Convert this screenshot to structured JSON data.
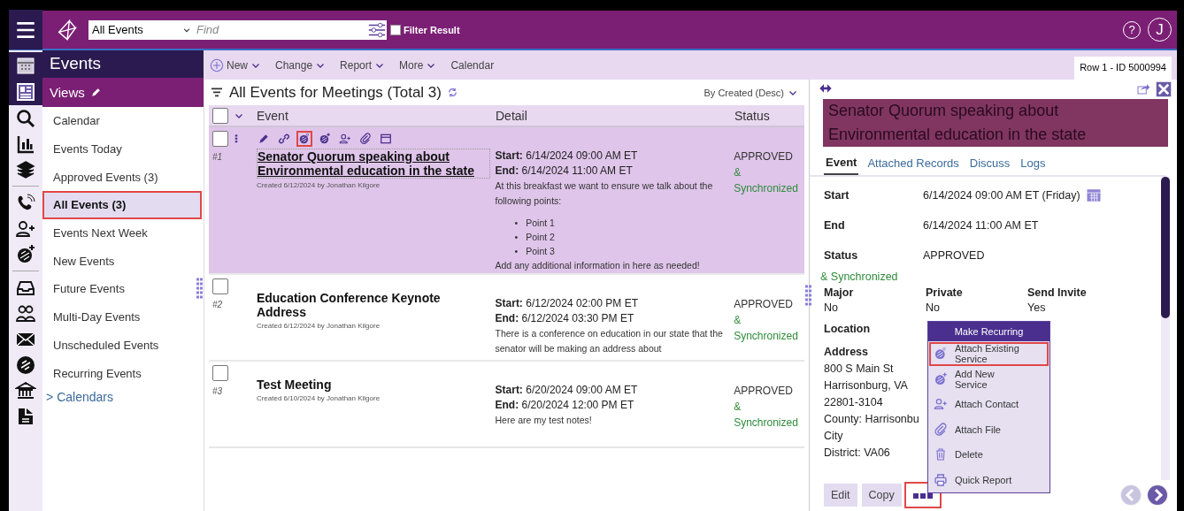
{
  "topbar": {
    "view_select": "All Events",
    "search": {
      "placeholder": "Find"
    },
    "filter_result": {
      "label": "Filter Result",
      "checked": false
    },
    "help": "?",
    "avatar": "J"
  },
  "module": {
    "title": "Events"
  },
  "views": {
    "title": "Views",
    "items": [
      {
        "label": "Calendar",
        "selected": false,
        "highlighted": false
      },
      {
        "label": "Events Today",
        "selected": false,
        "highlighted": false
      },
      {
        "label": "Approved Events (3)",
        "selected": false,
        "highlighted": false
      },
      {
        "label": "All Events (3)",
        "selected": true,
        "highlighted": true
      },
      {
        "label": "Events Next Week",
        "selected": false,
        "highlighted": false
      },
      {
        "label": "New Events",
        "selected": false,
        "highlighted": false
      },
      {
        "label": "Future Events",
        "selected": false,
        "highlighted": false
      },
      {
        "label": "Multi-Day Events",
        "selected": false,
        "highlighted": false
      },
      {
        "label": "Unscheduled Events",
        "selected": false,
        "highlighted": false
      },
      {
        "label": "Recurring Events",
        "selected": false,
        "highlighted": false
      }
    ],
    "calendars": {
      "marker": ">",
      "label": "Calendars",
      "expanded": false
    }
  },
  "toolbar": {
    "buttons": [
      {
        "label": "New",
        "kind": "add"
      },
      {
        "label": "Change",
        "kind": "menu"
      },
      {
        "label": "Report",
        "kind": "menu"
      },
      {
        "label": "More",
        "kind": "menu"
      },
      {
        "label": "Calendar",
        "kind": "plain"
      }
    ],
    "row_id": "Row 1 - ID 5000994"
  },
  "list": {
    "select_all_checked": false,
    "title": "All Events for Meetings (Total 3)",
    "sort": "By Created (Desc)",
    "columns": [
      "Event",
      "Detail",
      "Status"
    ],
    "rows": [
      {
        "number": "#1",
        "selected": true,
        "checked": false,
        "title": "Senator Quorum speaking about Environmental education in the state",
        "created": "Created 6/12/2024 by Jonathan Kilgore",
        "actions": [
          {
            "kind": "edit",
            "highlighted": false
          },
          {
            "kind": "link",
            "highlighted": false
          },
          {
            "kind": "service",
            "highlighted": true
          },
          {
            "kind": "service-add",
            "highlighted": false
          },
          {
            "kind": "person-add",
            "highlighted": false
          },
          {
            "kind": "attach",
            "highlighted": false
          },
          {
            "kind": "window",
            "highlighted": false
          }
        ],
        "start": "**Start:** 6/14/2024 09:00 AM ET",
        "end": "**End:** 6/14/2024 11:00 AM ET",
        "notes": [
          {
            "kind": "paragraph",
            "text": "At this breakfast we want to ensure we talk about the following points:"
          },
          {
            "kind": "bullets",
            "marker": "•",
            "items": [
              "Point 1",
              "Point 2",
              "Point 3"
            ]
          },
          {
            "kind": "paragraph",
            "text": "Add any additional information in here as needed!"
          }
        ],
        "status": "APPROVED",
        "sync": "& Synchronized"
      },
      {
        "number": "#2",
        "selected": false,
        "checked": false,
        "title": "Education Conference Keynote Address",
        "created": "Created 6/12/2024 by Jonathan Kilgore",
        "start": "**Start:** 6/12/2024 02:00 PM ET",
        "end": "**End:** 6/12/2024 03:30 PM ET",
        "notes": [
          {
            "kind": "paragraph",
            "text": "There is a conference on education in our state that the senator will be making an address about"
          }
        ],
        "status": "APPROVED",
        "sync": "& Synchronized"
      },
      {
        "number": "#3",
        "selected": false,
        "checked": false,
        "title": "Test Meeting",
        "created": "Created 6/10/2024 by Jonathan Kilgore",
        "start": "**Start:** 6/20/2024 09:00 AM ET",
        "end": "**End:** 6/20/2024 12:00 PM ET",
        "notes": [
          {
            "kind": "paragraph",
            "text": "Here are my test notes!"
          }
        ],
        "status": "APPROVED",
        "sync": "& Synchronized"
      }
    ]
  },
  "detail": {
    "title": "Senator Quorum speaking about Environmental education in the state",
    "tabs": [
      {
        "label": "Event",
        "selected": true
      },
      {
        "label": "Attached Records",
        "selected": false
      },
      {
        "label": "Discuss",
        "selected": false
      },
      {
        "label": "Logs",
        "selected": false
      }
    ],
    "fields": [
      {
        "label": "Start",
        "value": "6/14/2024 09:00 AM ET (Friday)",
        "calendar": true
      },
      {
        "label": "End",
        "value": "6/14/2024 11:00 AM ET",
        "calendar": false
      },
      {
        "label": "Status",
        "value": "APPROVED",
        "calendar": false
      }
    ],
    "sync": "& Synchronized",
    "flags": [
      {
        "label": "Major",
        "value": "No"
      },
      {
        "label": "Private",
        "value": "No"
      },
      {
        "label": "Send Invite",
        "value": "Yes"
      }
    ],
    "location": {
      "label": "Location"
    },
    "address": {
      "label": "Address",
      "lines": [
        "800 S Main St",
        "Harrisonburg, VA",
        "22801-3104",
        "County: Harrisonbu",
        "City",
        "District: VA06"
      ]
    },
    "buttons": [
      {
        "label": "Edit",
        "kind": "text",
        "highlighted": false
      },
      {
        "label": "Copy",
        "kind": "text",
        "highlighted": false
      },
      {
        "kind": "more",
        "highlighted": true
      }
    ],
    "nav": {
      "previous_disabled": true,
      "next_disabled": false
    },
    "menu": {
      "header": "Make Recurring",
      "items": [
        {
          "label": "Attach Existing Service",
          "kind": "service",
          "highlighted": true
        },
        {
          "label": "Add New Service",
          "kind": "service-add",
          "highlighted": false
        },
        {
          "label": "Attach Contact",
          "kind": "person-add",
          "highlighted": false
        },
        {
          "label": "Attach File",
          "kind": "attach",
          "highlighted": false
        },
        {
          "label": "Delete",
          "kind": "trash",
          "highlighted": false
        },
        {
          "label": "Quick Report",
          "kind": "printer",
          "highlighted": false
        }
      ]
    }
  }
}
